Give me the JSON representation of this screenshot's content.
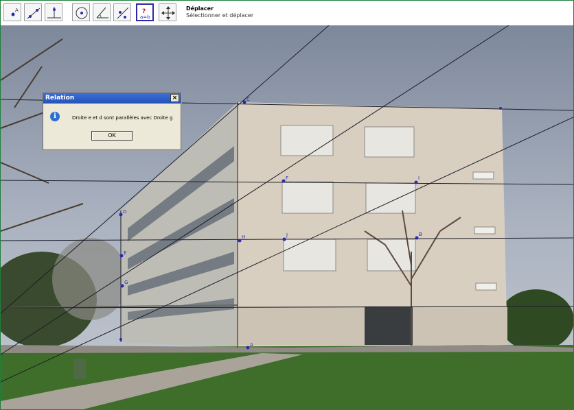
{
  "toolbar": {
    "tools": [
      {
        "name": "point-tool"
      },
      {
        "name": "line-tool"
      },
      {
        "name": "perpendicular-tool"
      },
      {
        "name": "circle-tool"
      },
      {
        "name": "angle-tool"
      },
      {
        "name": "reflect-tool"
      },
      {
        "name": "relation-tool",
        "active": true
      },
      {
        "name": "move-view-tool"
      }
    ],
    "active_tool_name": "Déplacer",
    "active_tool_help": "Sélectionner et déplacer"
  },
  "dialog": {
    "title": "Relation",
    "close_label": "×",
    "info_icon": "i",
    "message": "Droite e et d sont parallèles avec Droite g",
    "ok_label": "OK"
  },
  "points": [
    {
      "label": "D"
    },
    {
      "label": "C"
    },
    {
      "label": "F"
    },
    {
      "label": "I"
    },
    {
      "label": "H"
    },
    {
      "label": "J"
    },
    {
      "label": "B"
    },
    {
      "label": "E"
    },
    {
      "label": "G"
    },
    {
      "label": "A"
    }
  ],
  "colors": {
    "frame": "#1f7f3a",
    "sky": "#9aa4b4",
    "building": "#d9cfc0",
    "grass": "#3e6e2a",
    "point": "#2a2ab0"
  }
}
